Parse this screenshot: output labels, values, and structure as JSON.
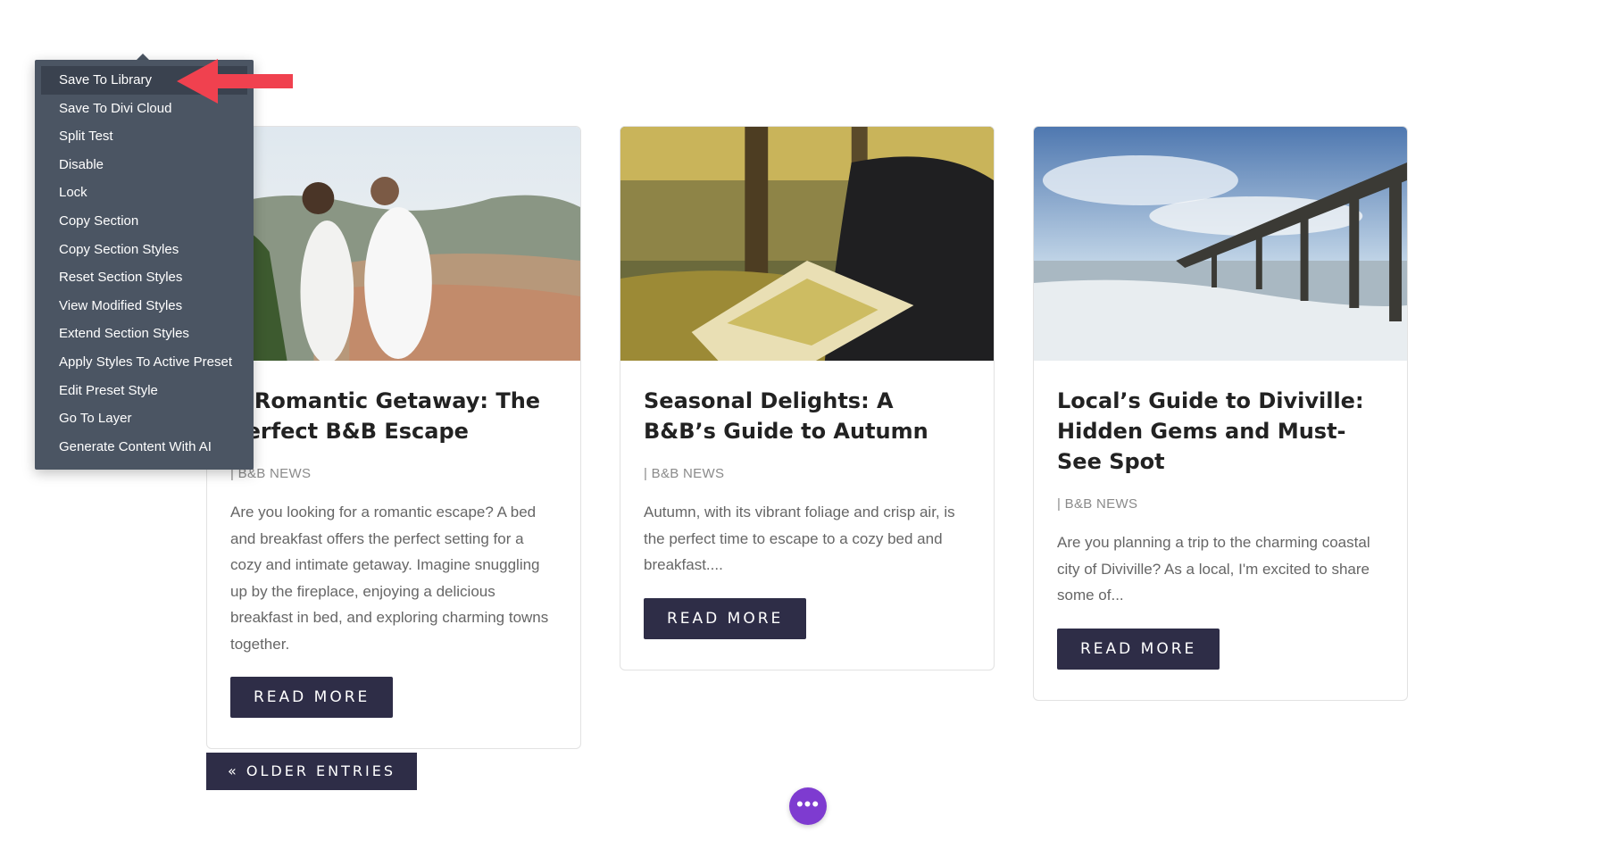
{
  "context_menu": {
    "items": [
      "Save To Library",
      "Save To Divi Cloud",
      "Split Test",
      "Disable",
      "Lock",
      "Copy Section",
      "Copy Section Styles",
      "Reset Section Styles",
      "View Modified Styles",
      "Extend Section Styles",
      "Apply Styles To Active Preset",
      "Edit Preset Style",
      "Go To Layer",
      "Generate Content With AI"
    ],
    "active_index": 0
  },
  "posts": [
    {
      "title": "A Romantic Getaway: The Perfect B&B Escape",
      "meta": "| B&B NEWS",
      "excerpt": "Are you looking for a romantic escape? A bed and breakfast offers the perfect setting for a cozy and intimate getaway. Imagine snuggling up by the fireplace, enjoying a delicious breakfast in bed, and exploring charming towns together.",
      "button": "READ MORE"
    },
    {
      "title": "Seasonal Delights: A B&B’s Guide to Autumn",
      "meta": "| B&B NEWS",
      "excerpt": "Autumn, with its vibrant foliage and crisp air, is the perfect time to escape to a cozy bed and breakfast....",
      "button": "READ MORE"
    },
    {
      "title": "Local’s Guide to Diviville: Hidden Gems and Must-See Spot",
      "meta": "| B&B NEWS",
      "excerpt": "Are you planning a trip to the charming coastal city of Diviville? As a local, I'm excited to share some of...",
      "button": "READ MORE"
    }
  ],
  "pagination": {
    "older_label": "« OLDER ENTRIES"
  },
  "fab": {
    "label": "•••"
  },
  "colors": {
    "button_bg": "#2e2d47",
    "menu_bg": "#4b5563",
    "fab_bg": "#7e3bd0",
    "arrow": "#f0414f"
  }
}
